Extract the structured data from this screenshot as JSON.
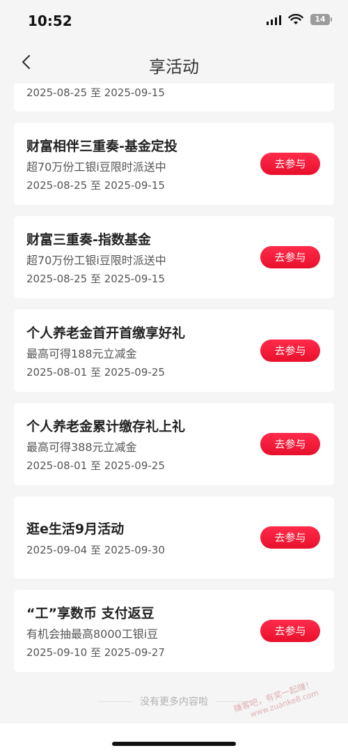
{
  "status": {
    "time": "10:52",
    "battery": "14"
  },
  "nav": {
    "title": "享活动"
  },
  "button_label": "去参与",
  "cards": [
    {
      "title": "",
      "subtitle": "",
      "date": "2025-08-25 至 2025-09-15"
    },
    {
      "title": "财富相伴三重奏-基金定投",
      "subtitle": "超70万份工银i豆限时派送中",
      "date": "2025-08-25 至 2025-09-15"
    },
    {
      "title": "财富三重奏-指数基金",
      "subtitle": "超70万份工银i豆限时派送中",
      "date": "2025-08-25 至 2025-09-15"
    },
    {
      "title": "个人养老金首开首缴享好礼",
      "subtitle": "最高可得188元立减金",
      "date": "2025-08-01 至 2025-09-25"
    },
    {
      "title": "个人养老金累计缴存礼上礼",
      "subtitle": "最高可得388元立减金",
      "date": "2025-08-01 至 2025-09-25"
    },
    {
      "title": "逛e生活9月活动",
      "subtitle": "",
      "date": "2025-09-04 至 2025-09-30"
    },
    {
      "title": "“工”享数币 支付返豆",
      "subtitle": "有机会抽最高8000工银i豆",
      "date": "2025-09-10 至 2025-09-27"
    }
  ],
  "footer": {
    "end_text": "没有更多内容啦"
  },
  "watermark": {
    "line1": "赚客吧，有奖一起赚！",
    "line2": "www.zuanke8.com"
  }
}
